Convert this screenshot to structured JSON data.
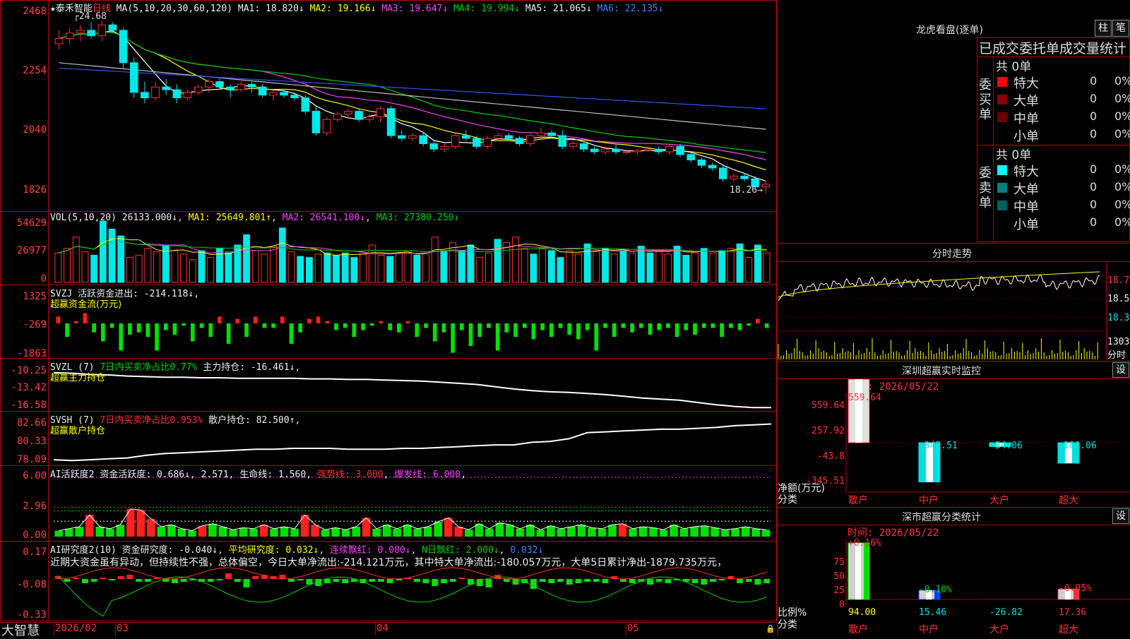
{
  "stock": {
    "name": "★泰禾智能",
    "period": "日线"
  },
  "brand": "大智慧",
  "main": {
    "ma_label": "MA(5,10,20,30,60,120)",
    "ma1": "MA1: 18.820↓",
    "ma2": "MA2: 19.166↓",
    "ma3": "MA3: 19.647↓",
    "ma4": "MA4: 19.994↓",
    "ma5": "MA5: 21.065↓",
    "ma6": "MA6: 22.135↓",
    "y_labels": [
      "2468",
      "2254",
      "2040",
      "1826"
    ],
    "high_mark": "24.68",
    "low_mark": "18.26→",
    "candles": [
      [
        23.8,
        24.3,
        23.6,
        24.0
      ],
      [
        24.0,
        24.4,
        23.8,
        24.2
      ],
      [
        24.2,
        24.5,
        23.9,
        24.3
      ],
      [
        24.3,
        24.6,
        24.0,
        24.1
      ],
      [
        24.1,
        24.68,
        23.9,
        24.5
      ],
      [
        24.5,
        24.6,
        24.2,
        24.3
      ],
      [
        24.3,
        24.4,
        22.9,
        23.1
      ],
      [
        23.1,
        23.3,
        21.8,
        22.0
      ],
      [
        22.0,
        22.4,
        21.6,
        21.8
      ],
      [
        21.8,
        22.4,
        21.7,
        22.2
      ],
      [
        22.2,
        22.5,
        21.9,
        22.1
      ],
      [
        22.1,
        22.3,
        21.6,
        21.8
      ],
      [
        21.8,
        22.1,
        21.7,
        22.0
      ],
      [
        22.0,
        22.3,
        21.9,
        22.2
      ],
      [
        22.2,
        22.5,
        22.0,
        22.4
      ],
      [
        22.4,
        22.5,
        22.1,
        22.2
      ],
      [
        22.2,
        22.3,
        21.8,
        22.1
      ],
      [
        22.1,
        22.4,
        22.0,
        22.3
      ],
      [
        22.3,
        22.4,
        22.0,
        22.2
      ],
      [
        22.2,
        22.3,
        21.8,
        21.9
      ],
      [
        21.9,
        22.1,
        21.7,
        22.0
      ],
      [
        22.0,
        22.1,
        21.8,
        21.9
      ],
      [
        21.9,
        22.0,
        21.7,
        21.8
      ],
      [
        21.8,
        21.9,
        21.2,
        21.3
      ],
      [
        21.3,
        21.5,
        20.4,
        20.5
      ],
      [
        20.5,
        21.1,
        20.4,
        21.0
      ],
      [
        21.0,
        21.3,
        20.9,
        21.2
      ],
      [
        21.2,
        21.4,
        21.0,
        21.3
      ],
      [
        21.3,
        21.4,
        20.9,
        21.0
      ],
      [
        21.0,
        21.2,
        20.9,
        21.1
      ],
      [
        21.1,
        21.5,
        20.9,
        21.4
      ],
      [
        21.4,
        21.5,
        20.3,
        20.4
      ],
      [
        20.4,
        20.6,
        20.2,
        20.3
      ],
      [
        20.3,
        20.5,
        20.2,
        20.4
      ],
      [
        20.4,
        20.5,
        20.0,
        20.1
      ],
      [
        20.1,
        20.2,
        19.8,
        19.9
      ],
      [
        19.9,
        20.1,
        19.8,
        20.0
      ],
      [
        20.0,
        20.5,
        19.9,
        20.4
      ],
      [
        20.4,
        20.6,
        20.2,
        20.3
      ],
      [
        20.3,
        20.4,
        19.9,
        20.0
      ],
      [
        20.0,
        20.4,
        19.9,
        20.3
      ],
      [
        20.3,
        20.5,
        20.2,
        20.4
      ],
      [
        20.4,
        20.5,
        20.2,
        20.3
      ],
      [
        20.3,
        20.4,
        20.0,
        20.1
      ],
      [
        20.1,
        20.5,
        20.0,
        20.4
      ],
      [
        20.4,
        20.7,
        20.3,
        20.5
      ],
      [
        20.5,
        20.6,
        20.3,
        20.4
      ],
      [
        20.4,
        20.6,
        19.9,
        20.0
      ],
      [
        20.0,
        20.2,
        19.9,
        20.1
      ],
      [
        20.1,
        20.2,
        19.8,
        19.9
      ],
      [
        19.9,
        20.0,
        19.7,
        19.8
      ],
      [
        19.8,
        20.0,
        19.7,
        19.9
      ],
      [
        19.9,
        20.1,
        19.7,
        19.8
      ],
      [
        19.8,
        19.9,
        19.7,
        19.8
      ],
      [
        19.8,
        19.9,
        19.7,
        19.85
      ],
      [
        19.85,
        20.0,
        19.8,
        19.9
      ],
      [
        19.9,
        20.0,
        19.7,
        19.8
      ],
      [
        19.8,
        20.1,
        19.7,
        20.0
      ],
      [
        20.0,
        20.1,
        19.6,
        19.7
      ],
      [
        19.7,
        19.8,
        19.4,
        19.5
      ],
      [
        19.5,
        19.6,
        19.2,
        19.3
      ],
      [
        19.3,
        19.4,
        19.1,
        19.2
      ],
      [
        19.2,
        19.3,
        18.7,
        18.8
      ],
      [
        18.8,
        19.0,
        18.7,
        18.9
      ],
      [
        18.9,
        19.0,
        18.7,
        18.8
      ],
      [
        18.8,
        18.9,
        18.4,
        18.5
      ],
      [
        18.5,
        18.7,
        18.26,
        18.6
      ]
    ]
  },
  "vol": {
    "label": "VOL(5,10,20)",
    "value": "26133.000↓",
    "ma1": "MA1: 25649.801↑",
    "ma2": "MA2: 26541.100↓",
    "ma3": "MA3: 27380.250↓",
    "y_labels": [
      "54629",
      "26977",
      "0"
    ],
    "bars": [
      [
        26,
        1
      ],
      [
        30,
        1
      ],
      [
        40,
        1
      ],
      [
        27,
        1
      ],
      [
        24,
        0
      ],
      [
        54,
        0
      ],
      [
        47,
        0
      ],
      [
        41,
        0
      ],
      [
        22,
        1
      ],
      [
        24,
        1
      ],
      [
        30,
        1
      ],
      [
        27,
        1
      ],
      [
        33,
        0
      ],
      [
        28,
        1
      ],
      [
        25,
        1
      ],
      [
        20,
        1
      ],
      [
        28,
        0
      ],
      [
        22,
        1
      ],
      [
        30,
        0
      ],
      [
        26,
        0
      ],
      [
        33,
        0
      ],
      [
        42,
        0
      ],
      [
        28,
        1
      ],
      [
        25,
        1
      ],
      [
        32,
        1
      ],
      [
        48,
        0
      ],
      [
        27,
        1
      ],
      [
        23,
        0
      ],
      [
        22,
        0
      ],
      [
        25,
        1
      ],
      [
        26,
        0
      ],
      [
        24,
        0
      ],
      [
        26,
        0
      ],
      [
        22,
        0
      ],
      [
        26,
        1
      ],
      [
        33,
        1
      ],
      [
        24,
        1
      ],
      [
        23,
        0
      ],
      [
        26,
        1
      ],
      [
        28,
        1
      ],
      [
        24,
        0
      ],
      [
        26,
        1
      ],
      [
        40,
        1
      ],
      [
        28,
        0
      ],
      [
        35,
        1
      ],
      [
        28,
        0
      ],
      [
        33,
        0
      ],
      [
        22,
        1
      ],
      [
        26,
        1
      ],
      [
        38,
        0
      ],
      [
        35,
        1
      ],
      [
        40,
        1
      ],
      [
        30,
        1
      ],
      [
        25,
        0
      ],
      [
        30,
        1
      ],
      [
        28,
        0
      ],
      [
        22,
        0
      ],
      [
        28,
        1
      ],
      [
        25,
        1
      ],
      [
        34,
        0
      ],
      [
        28,
        1
      ],
      [
        30,
        0
      ],
      [
        25,
        1
      ],
      [
        28,
        0
      ],
      [
        26,
        1
      ],
      [
        32,
        0
      ],
      [
        26,
        0
      ],
      [
        27,
        1
      ],
      [
        25,
        1
      ],
      [
        32,
        0
      ],
      [
        24,
        0
      ],
      [
        26,
        1
      ],
      [
        30,
        0
      ],
      [
        26,
        1
      ],
      [
        28,
        0
      ],
      [
        30,
        1
      ],
      [
        34,
        0
      ],
      [
        22,
        1
      ],
      [
        33,
        0
      ],
      [
        26,
        1
      ]
    ]
  },
  "svzj": {
    "label": "SVZJ",
    "title": "活跃资金进出: -214.118↓",
    "subtitle": "超赢资金流(万元)",
    "y_labels": [
      "1325",
      "-269",
      "-1863"
    ],
    "bars": [
      30,
      -60,
      10,
      45,
      -40,
      -80,
      -20,
      -120,
      -50,
      -40,
      -60,
      -120,
      -30,
      -50,
      -10,
      -80,
      -20,
      -60,
      30,
      -90,
      20,
      -60,
      30,
      -20,
      -20,
      30,
      -90,
      -40,
      20,
      30,
      10,
      -30,
      -20,
      -60,
      -30,
      -10,
      10,
      -30,
      -40,
      10,
      -60,
      -20,
      -80,
      -40,
      -130,
      -30,
      -100,
      -60,
      -20,
      -120,
      -40,
      -60,
      -20,
      -70,
      -30,
      -60,
      -20,
      -50,
      -70,
      -30,
      -120,
      -20,
      -60,
      -20,
      -40,
      -20,
      -50,
      -30,
      -20,
      -60,
      -30,
      -50,
      -20,
      -20,
      -60,
      -20,
      -30,
      -10,
      20,
      -20
    ]
  },
  "svzl": {
    "label": "SVZL (7)",
    "ratio": "7日内买卖净占比0.77%",
    "hold": "主力持仓: -16.461↓",
    "subtitle": "超赢主力持仓",
    "y_labels": [
      "-10.25",
      "-13.42",
      "-16.58"
    ],
    "line": [
      -10.3,
      -10.4,
      -10.6,
      -10.7,
      -10.9,
      -11.0,
      -11.1,
      -11.1,
      -11.2,
      -11.2,
      -11.3,
      -11.3,
      -11.3,
      -11.3,
      -11.4,
      -11.4,
      -11.5,
      -11.5,
      -11.6,
      -11.7,
      -11.8,
      -12.0,
      -12.2,
      -12.4,
      -12.8,
      -13.2,
      -13.5,
      -13.7,
      -13.8,
      -14.0,
      -14.2,
      -14.5,
      -14.8,
      -15.0,
      -15.2,
      -15.6,
      -16.0,
      -16.3,
      -16.5,
      -16.5
    ]
  },
  "svsh": {
    "label": "SVSH (7)",
    "ratio": "7日内买卖净占比0.953%",
    "hold": "散户持仓: 82.500↑",
    "subtitle": "超赢散户持仓",
    "y_labels": [
      "82.66",
      "80.33",
      "78.09"
    ],
    "line": [
      78.4,
      78.3,
      78.4,
      78.5,
      78.6,
      78.9,
      79.1,
      79.2,
      79.3,
      79.4,
      79.5,
      79.6,
      79.6,
      79.7,
      79.7,
      79.7,
      79.6,
      79.6,
      79.6,
      79.7,
      79.7,
      79.8,
      79.9,
      80.0,
      80.1,
      80.1,
      80.4,
      80.5,
      80.8,
      81.5,
      81.6,
      81.7,
      81.8,
      81.9,
      81.9,
      82.0,
      82.1,
      82.3,
      82.4,
      82.5
    ]
  },
  "ai_active": {
    "label": "AI活跃度2",
    "cap": "资金活跃度: 0.686↓",
    "cap2": "2.571",
    "life": "生命线: 1.560",
    "strong": "强势线: 3.000",
    "burst": "爆发线: 6.000",
    "y_labels": [
      "6.00",
      "2.96",
      "0.00"
    ],
    "bars": [
      [
        0.6,
        1
      ],
      [
        0.8,
        1
      ],
      [
        1.0,
        1
      ],
      [
        2.2,
        0
      ],
      [
        1.0,
        1
      ],
      [
        0.8,
        1
      ],
      [
        1.2,
        1
      ],
      [
        2.8,
        0
      ],
      [
        2.7,
        0
      ],
      [
        1.8,
        0
      ],
      [
        1.0,
        1
      ],
      [
        1.2,
        1
      ],
      [
        0.8,
        1
      ],
      [
        0.6,
        1
      ],
      [
        1.1,
        0
      ],
      [
        1.3,
        1
      ],
      [
        1.0,
        1
      ],
      [
        0.7,
        1
      ],
      [
        0.9,
        1
      ],
      [
        0.8,
        1
      ],
      [
        1.2,
        0
      ],
      [
        0.8,
        1
      ],
      [
        1.0,
        1
      ],
      [
        0.8,
        1
      ],
      [
        2.2,
        0
      ],
      [
        1.2,
        0
      ],
      [
        0.7,
        1
      ],
      [
        0.9,
        1
      ],
      [
        0.7,
        1
      ],
      [
        1.0,
        1
      ],
      [
        1.9,
        0
      ],
      [
        0.8,
        1
      ],
      [
        1.2,
        1
      ],
      [
        0.8,
        1
      ],
      [
        1.2,
        1
      ],
      [
        0.8,
        1
      ],
      [
        1.0,
        1
      ],
      [
        1.5,
        1
      ],
      [
        1.9,
        0
      ],
      [
        1.0,
        0
      ],
      [
        0.7,
        1
      ],
      [
        1.3,
        1
      ],
      [
        0.8,
        1
      ],
      [
        1.4,
        1
      ],
      [
        1.2,
        1
      ],
      [
        0.8,
        1
      ],
      [
        1.2,
        1
      ],
      [
        0.7,
        1
      ],
      [
        1.1,
        1
      ],
      [
        0.8,
        1
      ],
      [
        1.0,
        1
      ],
      [
        1.2,
        1
      ],
      [
        0.9,
        1
      ],
      [
        0.8,
        1
      ],
      [
        1.2,
        1
      ],
      [
        1.3,
        0
      ],
      [
        0.8,
        1
      ],
      [
        1.0,
        1
      ],
      [
        0.9,
        1
      ],
      [
        0.7,
        1
      ],
      [
        1.2,
        1
      ],
      [
        0.8,
        1
      ],
      [
        1.0,
        1
      ],
      [
        1.1,
        1
      ],
      [
        0.9,
        1
      ],
      [
        0.7,
        1
      ],
      [
        0.8,
        1
      ],
      [
        1.0,
        1
      ],
      [
        0.8,
        1
      ],
      [
        0.7,
        1
      ]
    ]
  },
  "ai_research": {
    "label": "AI研究度2(10)",
    "research": "资金研究度: -0.040↓",
    "avg": "平均研究度: 0.032↓",
    "cont": "连续飘红: 0.000↓",
    "nred": "N日飘红: 2.000↓",
    "last": "0.032↓",
    "summary": "近期大资金虽有异动，但持续性不强，总体偏空，今日大单净流出:-214.121万元，其中特大单净流出:-180.057万元，大单5日累计净出-1879.735万元，",
    "y_labels": [
      "0.17",
      "-0.08",
      "-0.33"
    ],
    "bars": [
      0.02,
      -0.02,
      0.01,
      -0.03,
      -0.02,
      0.01,
      -0.01,
      0.02,
      0.03,
      -0.02,
      -0.02,
      0.01,
      -0.02,
      -0.03,
      -0.02,
      -0.01,
      -0.02,
      -0.02,
      -0.01,
      0.04,
      -0.02,
      -0.06,
      0.02,
      0.03,
      0.02,
      0.03,
      -0.02,
      -0.01,
      -0.04,
      -0.05,
      -0.03,
      -0.02,
      -0.03,
      -0.02,
      -0.03,
      -0.02,
      -0.02,
      -0.03,
      -0.01,
      0.01,
      -0.02,
      -0.03,
      -0.05,
      -0.03,
      -0.02,
      0.01,
      -0.04,
      -0.05,
      -0.06,
      0.03,
      -0.02,
      -0.04,
      -0.03,
      -0.07,
      -0.02,
      -0.03,
      -0.02,
      -0.04,
      -0.03,
      -0.02,
      -0.02,
      -0.03,
      0.02,
      -0.02,
      -0.03,
      -0.02,
      -0.04,
      -0.02,
      -0.03,
      -0.01,
      -0.02,
      -0.03,
      -0.04,
      -0.02,
      -0.01,
      0.02,
      -0.03,
      -0.02,
      -0.04,
      -0.03
    ]
  },
  "x_axis": {
    "labels": [
      "2026/02",
      "03",
      "04",
      "05"
    ]
  },
  "lhb": {
    "title": "龙虎看盘(逐单)",
    "btn_col": "柱",
    "btn_pen": "笔",
    "header": "已成交委托单成交量统计",
    "buy_side": "委买单",
    "sell_side": "委卖单",
    "buy_total": "共 0单",
    "sell_total": "共 0单",
    "buy_rows": [
      {
        "label": "特大",
        "vol": "0",
        "pct": "0%",
        "color": "#ff0000"
      },
      {
        "label": "大单",
        "vol": "0",
        "pct": "0%",
        "color": "#8b0000"
      },
      {
        "label": "中单",
        "vol": "0",
        "pct": "0%",
        "color": "#6b0000"
      },
      {
        "label": "小单",
        "vol": "0",
        "pct": "0%",
        "color": "#000000"
      }
    ],
    "sell_rows": [
      {
        "label": "特大",
        "vol": "0",
        "pct": "0%",
        "color": "#00ffff"
      },
      {
        "label": "大单",
        "vol": "0",
        "pct": "0%",
        "color": "#008080"
      },
      {
        "label": "中单",
        "vol": "0",
        "pct": "0%",
        "color": "#006060"
      },
      {
        "label": "小单",
        "vol": "0",
        "pct": "0%",
        "color": "#000000"
      }
    ]
  },
  "intraday": {
    "title": "分时走势",
    "y_labels": [
      "18.70",
      "18.52",
      "18.34"
    ],
    "vol_labels": [
      "1303",
      "分时"
    ]
  },
  "sz_monitor": {
    "title": "深圳超赢实时监控",
    "setting": "设",
    "time": "时间: 2026/05/22",
    "y_labels": [
      "559.64",
      "257.92",
      "-43.8",
      "-345.51"
    ],
    "axis_title": "净额(万元)",
    "axis_sub": "分类",
    "categories": [
      "散户",
      "中户",
      "大户",
      "超大"
    ],
    "values": [
      559.64,
      -345.51,
      -34.06,
      -180.06
    ],
    "value_labels": [
      "559.64",
      "-345.51",
      "-34.06",
      "-180.06"
    ]
  },
  "sz_class": {
    "title": "深市超赢分类统计",
    "setting": "设",
    "time": "时间: 2026/05/22",
    "y_labels": [
      "75",
      "50",
      "25",
      "0"
    ],
    "axis_title": "比例%",
    "axis_sub": "分类",
    "categories": [
      "散户",
      "中户",
      "大户",
      "超大"
    ],
    "top_labels": [
      "+0.16%",
      "-0.10%",
      "",
      "-0.05%"
    ],
    "values": [
      94.0,
      15.46,
      -26.82,
      17.36
    ],
    "value_labels": [
      "94.00",
      "15.46",
      "-26.82",
      "17.36"
    ]
  }
}
